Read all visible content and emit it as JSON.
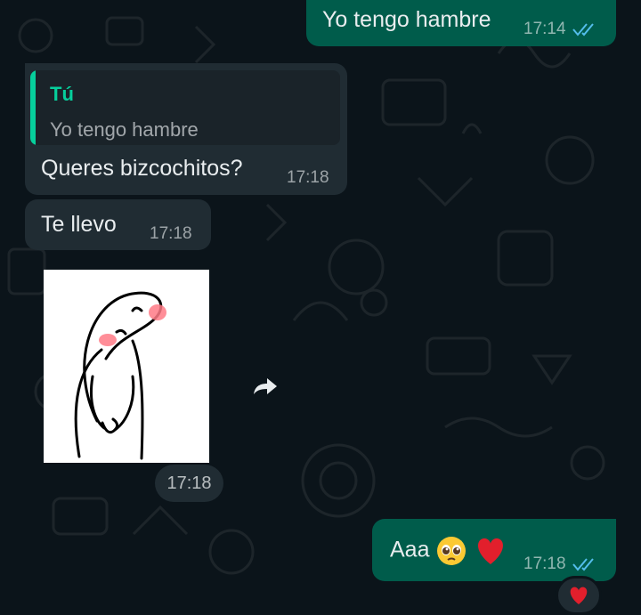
{
  "messages": [
    {
      "id": "m1",
      "direction": "outgoing",
      "text": "Yo tengo hambre",
      "time": "17:14",
      "status": "read"
    },
    {
      "id": "m2",
      "direction": "incoming",
      "quote": {
        "author": "Tú",
        "text": "Yo tengo hambre"
      },
      "text": "Queres bizcochitos?",
      "time": "17:18"
    },
    {
      "id": "m3",
      "direction": "incoming",
      "text": "Te llevo",
      "time": "17:18"
    },
    {
      "id": "m4",
      "direction": "incoming",
      "type": "sticker",
      "sticker_icon": "shy-character-sticker",
      "time": "17:18"
    },
    {
      "id": "m5",
      "direction": "outgoing",
      "text": "Aaa",
      "emojis": [
        "pleading-face-emoji",
        "red-heart-emoji"
      ],
      "time": "17:18",
      "status": "read",
      "reaction": "red-heart-emoji"
    }
  ],
  "colors": {
    "background": "#0b141a",
    "outgoing_bubble": "#005c4b",
    "incoming_bubble": "#202c33",
    "quote_accent": "#06cf9c",
    "read_ticks": "#53bdeb"
  }
}
